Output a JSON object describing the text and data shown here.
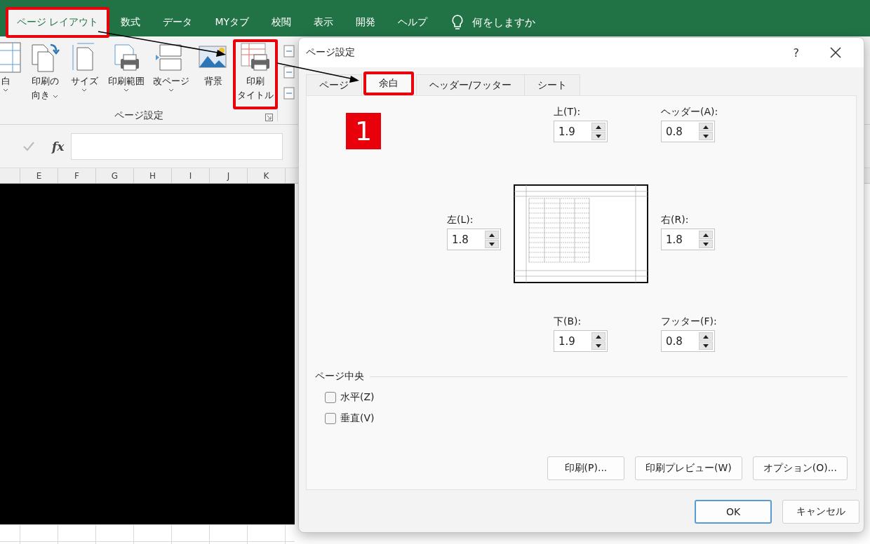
{
  "ribbon_tabs": [
    {
      "label": "ページ レイアウト",
      "selected": true,
      "highlighted": true
    },
    {
      "label": "数式",
      "selected": false,
      "highlighted": false
    },
    {
      "label": "データ",
      "selected": false,
      "highlighted": false
    },
    {
      "label": "MYタブ",
      "selected": false,
      "highlighted": false
    },
    {
      "label": "校閲",
      "selected": false,
      "highlighted": false
    },
    {
      "label": "表示",
      "selected": false,
      "highlighted": false
    },
    {
      "label": "開発",
      "selected": false,
      "highlighted": false
    },
    {
      "label": "ヘルプ",
      "selected": false,
      "highlighted": false
    }
  ],
  "tell_me": {
    "placeholder": "何をしますか"
  },
  "ribbon_buttons": [
    {
      "kind": "margins",
      "lines": [
        "白"
      ],
      "dropdown": true,
      "highlighted": false
    },
    {
      "kind": "orientation",
      "lines": [
        "印刷の",
        "向き"
      ],
      "dropdown": true,
      "highlighted": false
    },
    {
      "kind": "size",
      "lines": [
        "サイズ"
      ],
      "dropdown": true,
      "highlighted": false
    },
    {
      "kind": "print-area",
      "lines": [
        "印刷範囲"
      ],
      "dropdown": true,
      "highlighted": false
    },
    {
      "kind": "breaks",
      "lines": [
        "改ページ"
      ],
      "dropdown": true,
      "highlighted": false
    },
    {
      "kind": "background",
      "lines": [
        "背景"
      ],
      "dropdown": false,
      "highlighted": false
    },
    {
      "kind": "print-titles",
      "lines": [
        "印刷",
        "タイトル"
      ],
      "dropdown": false,
      "highlighted": true
    }
  ],
  "ribbon_group_label": "ページ設定",
  "formula_bar": {
    "function_label": "fx"
  },
  "column_headers": [
    "E",
    "F",
    "G",
    "H",
    "I",
    "J",
    "K"
  ],
  "dialog": {
    "title": "ページ設定",
    "help": "?",
    "tabs": [
      {
        "label": "ページ",
        "selected": false,
        "highlighted": false
      },
      {
        "label": "余白",
        "selected": true,
        "highlighted": true
      },
      {
        "label": "ヘッダー/フッター",
        "selected": false,
        "highlighted": false
      },
      {
        "label": "シート",
        "selected": false,
        "highlighted": false
      }
    ],
    "step_badge": "1",
    "margins": [
      {
        "kind": "top",
        "label": "上(T):",
        "value": "1.9"
      },
      {
        "kind": "header",
        "label": "ヘッダー(A):",
        "value": "0.8"
      },
      {
        "kind": "left",
        "label": "左(L):",
        "value": "1.8"
      },
      {
        "kind": "right",
        "label": "右(R):",
        "value": "1.8"
      },
      {
        "kind": "bottom",
        "label": "下(B):",
        "value": "1.9"
      },
      {
        "kind": "footer",
        "label": "フッター(F):",
        "value": "0.8"
      }
    ],
    "center_on_page": {
      "title": "ページ中央",
      "options": [
        {
          "label": "水平(Z)",
          "checked": false
        },
        {
          "label": "垂直(V)",
          "checked": false
        }
      ]
    },
    "panel_buttons": [
      "印刷(P)...",
      "印刷プレビュー(W)",
      "オプション(O)..."
    ],
    "footer_buttons": [
      {
        "label": "OK",
        "default": true
      },
      {
        "label": "キャンセル",
        "default": false
      }
    ]
  }
}
